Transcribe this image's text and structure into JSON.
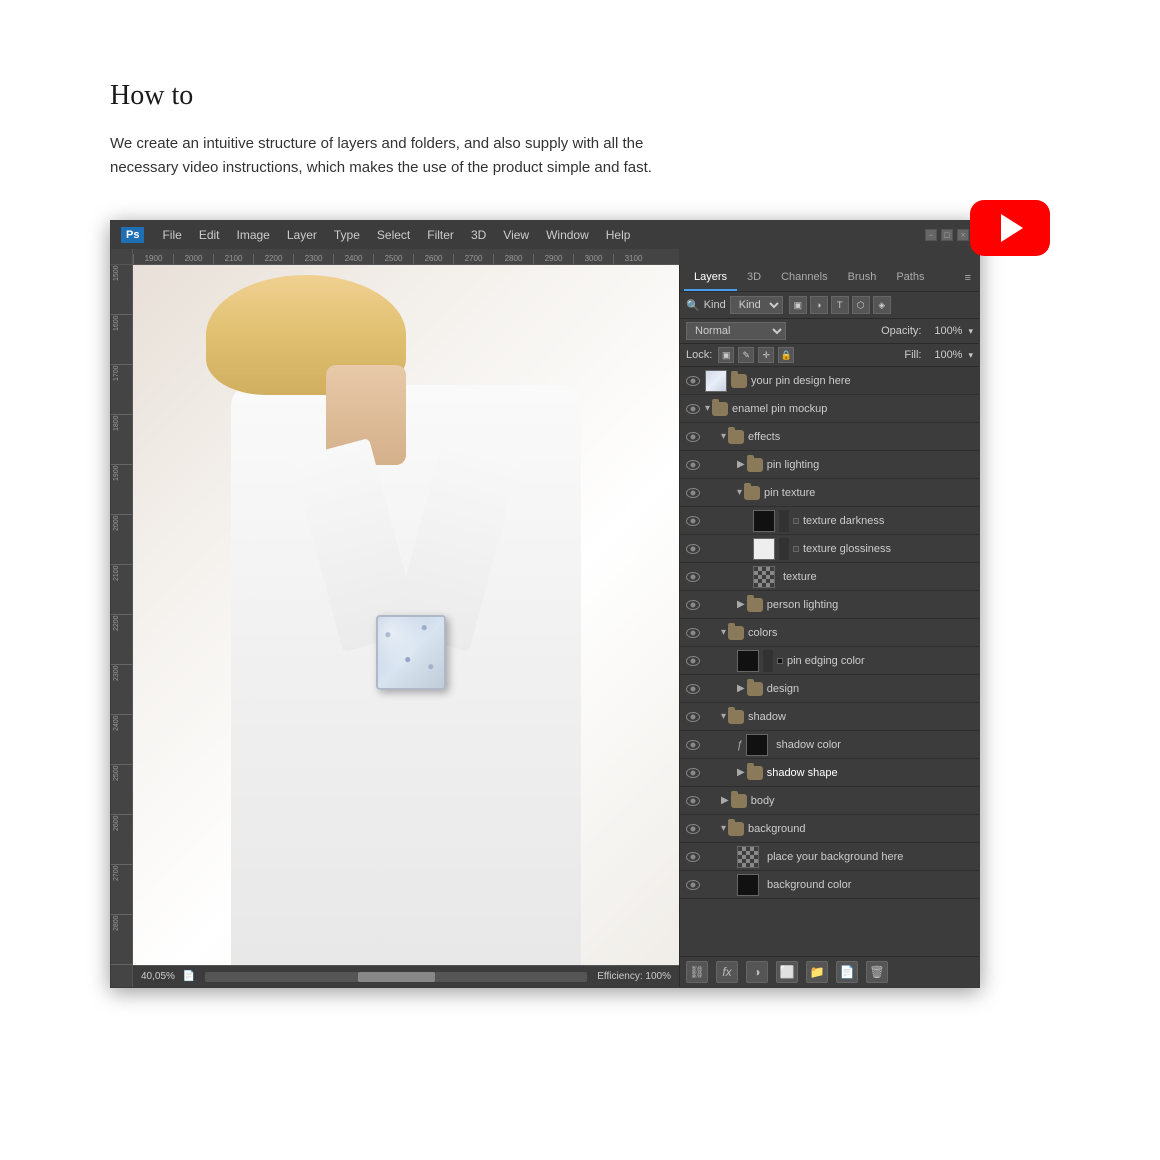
{
  "page": {
    "title": "How to",
    "description": "We create an intuitive structure of layers and folders, and also supply with all the necessary video instructions, which makes the use of the product simple and fast."
  },
  "photoshop": {
    "logo": "Ps",
    "menu": {
      "items": [
        "File",
        "Edit",
        "Image",
        "Layer",
        "Type",
        "Select",
        "Filter",
        "3D",
        "View",
        "Window",
        "Help"
      ]
    },
    "titlebar": {
      "minimize": "−",
      "maximize": "□",
      "close": "×"
    },
    "ruler": {
      "marks": [
        "1900",
        "2000",
        "2100",
        "2200",
        "2300",
        "2400",
        "2500",
        "2600",
        "2700",
        "2800",
        "2900",
        "3000",
        "3100"
      ]
    },
    "statusbar": {
      "zoom": "40,05%",
      "efficiency": "Efficiency: 100%"
    },
    "layers_panel": {
      "tabs": [
        "Layers",
        "3D",
        "Channels",
        "Brush",
        "Paths"
      ],
      "active_tab": "Layers",
      "filter": {
        "label": "Kind",
        "mode": "Normal",
        "opacity_label": "Opacity:",
        "opacity_value": "100%",
        "fill_label": "Fill:",
        "fill_value": "100%",
        "lock_label": "Lock:"
      },
      "layers": [
        {
          "id": 1,
          "indent": 0,
          "type": "layer-group",
          "name": "your pin design here",
          "visible": true,
          "expanded": false
        },
        {
          "id": 2,
          "indent": 0,
          "type": "folder",
          "name": "enamel pin mockup",
          "visible": true,
          "expanded": true
        },
        {
          "id": 3,
          "indent": 1,
          "type": "folder",
          "name": "effects",
          "visible": true,
          "expanded": true
        },
        {
          "id": 4,
          "indent": 2,
          "type": "folder-collapsed",
          "name": "pin lighting",
          "visible": true,
          "expanded": false
        },
        {
          "id": 5,
          "indent": 2,
          "type": "folder",
          "name": "pin texture",
          "visible": true,
          "expanded": true
        },
        {
          "id": 6,
          "indent": 3,
          "type": "layer",
          "name": "texture darkness",
          "visible": true,
          "thumb": "black-dot"
        },
        {
          "id": 7,
          "indent": 3,
          "type": "layer",
          "name": "texture glossiness",
          "visible": true,
          "thumb": "black-dot"
        },
        {
          "id": 8,
          "indent": 3,
          "type": "layer",
          "name": "texture",
          "visible": true,
          "thumb": "checker"
        },
        {
          "id": 9,
          "indent": 2,
          "type": "folder-collapsed",
          "name": "person lighting",
          "visible": true,
          "expanded": false
        },
        {
          "id": 10,
          "indent": 1,
          "type": "folder",
          "name": "colors",
          "visible": true,
          "expanded": true
        },
        {
          "id": 11,
          "indent": 2,
          "type": "layer",
          "name": "pin edging color",
          "visible": true,
          "thumb": "black-dark"
        },
        {
          "id": 12,
          "indent": 2,
          "type": "folder-collapsed",
          "name": "design",
          "visible": true,
          "expanded": false
        },
        {
          "id": 13,
          "indent": 1,
          "type": "folder",
          "name": "shadow",
          "visible": true,
          "expanded": true
        },
        {
          "id": 14,
          "indent": 2,
          "type": "layer",
          "name": "shadow color",
          "visible": true,
          "thumb": "black"
        },
        {
          "id": 15,
          "indent": 2,
          "type": "folder-collapsed",
          "name": "shadow shape",
          "visible": true,
          "expanded": false
        },
        {
          "id": 16,
          "indent": 1,
          "type": "folder-collapsed",
          "name": "body",
          "visible": true,
          "expanded": false
        },
        {
          "id": 17,
          "indent": 1,
          "type": "folder",
          "name": "background",
          "visible": true,
          "expanded": true
        },
        {
          "id": 18,
          "indent": 2,
          "type": "layer",
          "name": "place your background here",
          "visible": true,
          "thumb": "checker"
        },
        {
          "id": 19,
          "indent": 2,
          "type": "layer",
          "name": "background color",
          "visible": true,
          "thumb": "black"
        }
      ],
      "bottom_buttons": [
        "link",
        "fx",
        "new-layer",
        "adjustment",
        "folder",
        "trash",
        "delete"
      ]
    }
  },
  "youtube_button": {
    "label": "▶"
  }
}
